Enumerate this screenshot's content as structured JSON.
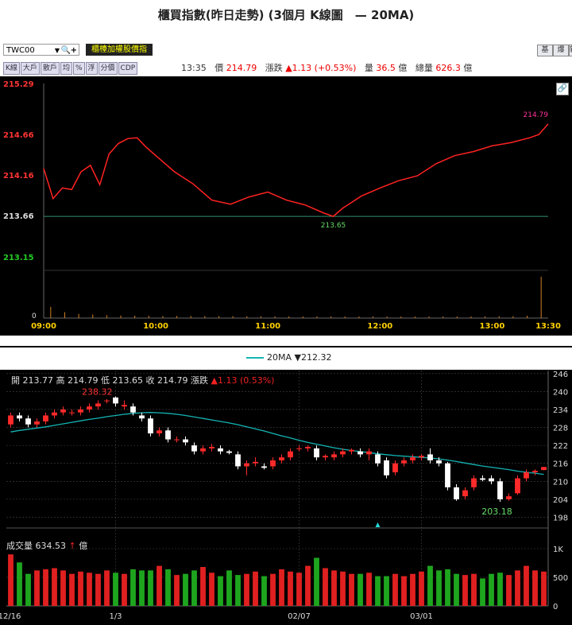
{
  "title": "櫃買指數(昨日走勢) (3個月 K線圖　— 20MA)",
  "toolbar": {
    "symbol": "TWC00",
    "index_name": "櫃檯加權股價指",
    "right_buttons": [
      "基",
      "爆",
      "新"
    ],
    "tabs": [
      "K線",
      "大戶",
      "散戶",
      "均",
      "%",
      "浮",
      "分價",
      "CDP"
    ]
  },
  "quote": {
    "time": "13:35",
    "price_label": "價",
    "price": "214.79",
    "change_label": "漲跌",
    "change": "▲1.13 (+0.53%)",
    "volume_label": "量",
    "volume": "36.5",
    "volume_unit": "億",
    "total_label": "總量",
    "total": "626.3",
    "total_unit": "億"
  },
  "intraday": {
    "y_ticks": [
      "215.29",
      "214.66",
      "214.16",
      "213.66",
      "213.15"
    ],
    "x_ticks": [
      "09:00",
      "10:00",
      "11:00",
      "12:00",
      "13:00",
      "13:30"
    ],
    "vol_zero": "0",
    "low_label": "213.65",
    "last_label": "214.79",
    "colors": {
      "line": "#ff2222",
      "up_tick": "#ff3333",
      "down_tick": "#22cc22",
      "volume": "#d08020",
      "ref": "#2f8f6f"
    }
  },
  "kline": {
    "legend": "20MA ▼212.32",
    "ohlc": {
      "open_label": "開",
      "open": "213.77",
      "high_label": "高",
      "high": "214.79",
      "low_label": "低",
      "low": "213.65",
      "close_label": "收",
      "close": "214.79",
      "chg_label": "漲跌",
      "chg": "▲1.13 (0.53%)"
    },
    "price_ticks": [
      "246",
      "240",
      "234",
      "228",
      "222",
      "216",
      "210",
      "204",
      "198"
    ],
    "vol_ticks": [
      "1K",
      "500",
      "0"
    ],
    "x_ticks": [
      "12/16",
      "1/3",
      "02/07",
      "03/01"
    ],
    "high_label": "238.32",
    "low_label": "203.18",
    "vol_header": "成交量 634.53",
    "vol_arrow": "↑",
    "vol_unit": "億",
    "colors": {
      "up": "#ff2a2a",
      "down": "#ffffff",
      "ma": "#14b4b4",
      "vol_up": "#e02020",
      "vol_down": "#1ea51e",
      "grid": "#444444"
    }
  },
  "chart_data": [
    {
      "type": "line",
      "title": "櫃買指數(昨日走勢)",
      "x_range": [
        "09:00",
        "13:30"
      ],
      "ylim": [
        213.15,
        215.29
      ],
      "series": [
        {
          "x": [
            "09:00",
            "09:05",
            "09:10",
            "09:15",
            "09:20",
            "09:25",
            "09:30",
            "09:35",
            "09:40",
            "09:45",
            "09:50",
            "09:55",
            "10:00",
            "10:10",
            "10:20",
            "10:30",
            "10:40",
            "10:50",
            "11:00",
            "11:10",
            "11:20",
            "11:30",
            "11:35",
            "11:40",
            "11:50",
            "12:00",
            "12:10",
            "12:20",
            "12:30",
            "12:40",
            "12:50",
            "13:00",
            "13:10",
            "13:20",
            "13:25",
            "13:30"
          ],
          "values": [
            214.24,
            213.87,
            214.0,
            213.98,
            214.2,
            214.28,
            214.04,
            214.42,
            214.55,
            214.61,
            214.62,
            214.5,
            214.4,
            214.2,
            214.05,
            213.85,
            213.8,
            213.89,
            213.95,
            213.85,
            213.79,
            213.69,
            213.65,
            213.75,
            213.9,
            214.0,
            214.09,
            214.15,
            214.3,
            214.4,
            214.45,
            214.52,
            214.56,
            214.62,
            214.66,
            214.79
          ]
        }
      ],
      "volume": [
        0.95,
        0.5,
        0.35,
        0.3,
        0.25,
        0.22,
        0.2,
        0.2,
        0.18,
        0.18,
        0.18,
        0.17,
        0.17,
        0.16,
        0.15,
        0.15,
        0.14,
        0.14,
        0.14,
        0.14,
        0.13,
        0.13,
        0.13,
        0.13,
        0.13,
        0.13,
        0.13,
        0.13,
        0.13,
        0.13,
        0.14,
        0.14,
        0.15,
        0.16,
        0.2,
        3.5
      ],
      "annotations": [
        {
          "label": "213.65",
          "x": "11:35",
          "y": 213.65
        },
        {
          "label": "214.79",
          "x": "13:30",
          "y": 214.79
        }
      ]
    },
    {
      "type": "candlestick",
      "title": "3個月 K線圖",
      "ylim": [
        196,
        247
      ],
      "x_ticks": [
        "12/16",
        "1/3",
        "02/07",
        "03/01"
      ],
      "candles": [
        {
          "o": 229,
          "h": 233,
          "l": 228,
          "c": 232
        },
        {
          "o": 232,
          "h": 233,
          "l": 230,
          "c": 231
        },
        {
          "o": 231,
          "h": 232,
          "l": 228,
          "c": 229
        },
        {
          "o": 229,
          "h": 231,
          "l": 228,
          "c": 230
        },
        {
          "o": 230,
          "h": 233,
          "l": 229,
          "c": 232
        },
        {
          "o": 232,
          "h": 234,
          "l": 231,
          "c": 233
        },
        {
          "o": 233,
          "h": 235,
          "l": 232,
          "c": 234
        },
        {
          "o": 233,
          "h": 234,
          "l": 232,
          "c": 233
        },
        {
          "o": 233,
          "h": 235,
          "l": 232,
          "c": 234
        },
        {
          "o": 234,
          "h": 236,
          "l": 233,
          "c": 235
        },
        {
          "o": 235,
          "h": 237,
          "l": 234,
          "c": 236
        },
        {
          "o": 237,
          "h": 237.5,
          "l": 236,
          "c": 237
        },
        {
          "o": 238,
          "h": 238.32,
          "l": 235,
          "c": 236
        },
        {
          "o": 235,
          "h": 237,
          "l": 234,
          "c": 235.5
        },
        {
          "o": 235,
          "h": 236,
          "l": 232,
          "c": 233
        },
        {
          "o": 232,
          "h": 233,
          "l": 230,
          "c": 231
        },
        {
          "o": 231,
          "h": 232,
          "l": 225,
          "c": 226
        },
        {
          "o": 226,
          "h": 228,
          "l": 225,
          "c": 227
        },
        {
          "o": 227,
          "h": 228,
          "l": 223,
          "c": 224
        },
        {
          "o": 224,
          "h": 225,
          "l": 223,
          "c": 224
        },
        {
          "o": 224,
          "h": 225,
          "l": 222,
          "c": 223
        },
        {
          "o": 222,
          "h": 223,
          "l": 219,
          "c": 220
        },
        {
          "o": 220,
          "h": 222,
          "l": 219,
          "c": 221
        },
        {
          "o": 221,
          "h": 222.5,
          "l": 220,
          "c": 221.5
        },
        {
          "o": 221,
          "h": 222,
          "l": 219,
          "c": 220
        },
        {
          "o": 220,
          "h": 220.5,
          "l": 219,
          "c": 219.5
        },
        {
          "o": 219,
          "h": 220,
          "l": 214,
          "c": 215
        },
        {
          "o": 215,
          "h": 217,
          "l": 212,
          "c": 216
        },
        {
          "o": 216,
          "h": 218,
          "l": 215,
          "c": 216.5
        },
        {
          "o": 215,
          "h": 216,
          "l": 214,
          "c": 214.5
        },
        {
          "o": 215,
          "h": 218,
          "l": 214,
          "c": 217
        },
        {
          "o": 217,
          "h": 219,
          "l": 216,
          "c": 218
        },
        {
          "o": 218,
          "h": 221,
          "l": 217,
          "c": 220
        },
        {
          "o": 221,
          "h": 222,
          "l": 220,
          "c": 221
        },
        {
          "o": 221,
          "h": 222,
          "l": 220,
          "c": 221.5
        },
        {
          "o": 221,
          "h": 222,
          "l": 217,
          "c": 218
        },
        {
          "o": 218,
          "h": 219,
          "l": 217,
          "c": 218.5
        },
        {
          "o": 218,
          "h": 220,
          "l": 217,
          "c": 219
        },
        {
          "o": 219,
          "h": 221,
          "l": 218,
          "c": 220
        },
        {
          "o": 220,
          "h": 221,
          "l": 219,
          "c": 220.5
        },
        {
          "o": 220,
          "h": 221,
          "l": 218,
          "c": 219
        },
        {
          "o": 219,
          "h": 221,
          "l": 217,
          "c": 220
        },
        {
          "o": 219,
          "h": 220,
          "l": 215,
          "c": 216
        },
        {
          "o": 217,
          "h": 218,
          "l": 211,
          "c": 212
        },
        {
          "o": 213,
          "h": 217,
          "l": 212,
          "c": 216
        },
        {
          "o": 216,
          "h": 218,
          "l": 215,
          "c": 217
        },
        {
          "o": 217,
          "h": 219,
          "l": 216,
          "c": 218
        },
        {
          "o": 218,
          "h": 219,
          "l": 217,
          "c": 218.5
        },
        {
          "o": 219,
          "h": 221,
          "l": 216,
          "c": 217
        },
        {
          "o": 217,
          "h": 218,
          "l": 215,
          "c": 216
        },
        {
          "o": 216,
          "h": 216.5,
          "l": 207,
          "c": 208
        },
        {
          "o": 208,
          "h": 209,
          "l": 203.5,
          "c": 204
        },
        {
          "o": 205,
          "h": 208,
          "l": 204,
          "c": 207
        },
        {
          "o": 208,
          "h": 212,
          "l": 207,
          "c": 211
        },
        {
          "o": 211,
          "h": 212,
          "l": 210,
          "c": 210.5
        },
        {
          "o": 211,
          "h": 212,
          "l": 209,
          "c": 210
        },
        {
          "o": 210,
          "h": 211,
          "l": 203.18,
          "c": 204
        },
        {
          "o": 204,
          "h": 206,
          "l": 203.5,
          "c": 205
        },
        {
          "o": 206,
          "h": 212,
          "l": 205.5,
          "c": 211
        },
        {
          "o": 211,
          "h": 214,
          "l": 210,
          "c": 213
        },
        {
          "o": 213,
          "h": 214,
          "l": 212,
          "c": 213.5
        },
        {
          "o": 213.77,
          "h": 214.79,
          "l": 213.65,
          "c": 214.79
        }
      ],
      "ma20": [
        226.5,
        227.0,
        227.4,
        227.8,
        228.2,
        228.7,
        229.2,
        229.7,
        230.2,
        230.7,
        231.1,
        231.6,
        232.0,
        232.4,
        232.7,
        232.9,
        233.0,
        232.9,
        232.7,
        232.4,
        232.0,
        231.5,
        231.0,
        230.5,
        230.0,
        229.5,
        228.9,
        228.2,
        227.5,
        226.8,
        226.0,
        225.2,
        224.5,
        223.7,
        223.0,
        222.4,
        221.8,
        221.2,
        220.7,
        220.3,
        219.9,
        219.6,
        219.2,
        218.9,
        218.6,
        218.4,
        218.2,
        218.0,
        217.8,
        217.5,
        217.1,
        216.6,
        216.1,
        215.6,
        215.1,
        214.7,
        214.3,
        213.9,
        213.4,
        213.0,
        212.7,
        212.32
      ],
      "volume_axis": [
        0,
        1000
      ],
      "volume": [
        900,
        760,
        560,
        620,
        640,
        660,
        620,
        560,
        600,
        580,
        560,
        620,
        580,
        560,
        640,
        620,
        620,
        700,
        640,
        540,
        560,
        620,
        680,
        580,
        520,
        620,
        540,
        560,
        600,
        520,
        560,
        640,
        600,
        580,
        700,
        840,
        660,
        620,
        600,
        560,
        560,
        580,
        520,
        520,
        560,
        520,
        560,
        600,
        700,
        620,
        640,
        560,
        540,
        560,
        480,
        560,
        580,
        540,
        620,
        700,
        620,
        600
      ]
    }
  ]
}
